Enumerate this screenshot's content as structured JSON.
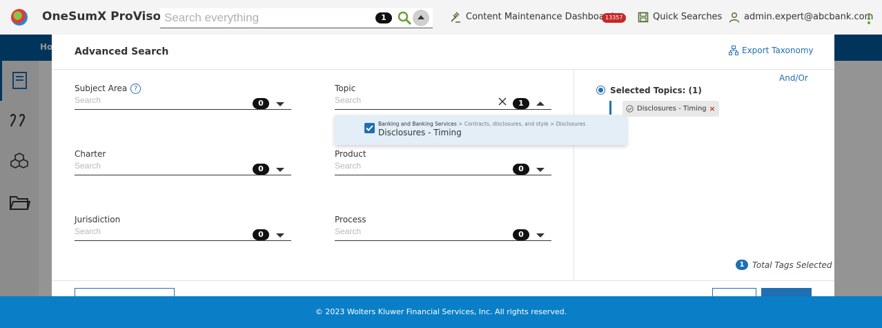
{
  "header": {
    "app_title": "OneSumX ProViso",
    "search_placeholder": "Search everything",
    "search_count": "1",
    "content_maintenance_label": "Content Maintenance Dashboard",
    "content_maintenance_badge": "13357",
    "quick_searches_label": "Quick Searches",
    "user_email": "admin.expert@abcbank.com"
  },
  "background_nav": {
    "home_label": "Ho"
  },
  "modal": {
    "title": "Advanced Search",
    "export_label": "Export Taxonomy",
    "fields": [
      {
        "label": "Subject Area",
        "placeholder": "Search",
        "count": "0"
      },
      {
        "label": "Topic",
        "placeholder": "Search",
        "count": "1"
      },
      {
        "label": "Charter",
        "placeholder": "Search",
        "count": "0"
      },
      {
        "label": "Product",
        "placeholder": "Search",
        "count": "0"
      },
      {
        "label": "Jurisdiction",
        "placeholder": "Search",
        "count": "0"
      },
      {
        "label": "Process",
        "placeholder": "Search",
        "count": "0"
      }
    ],
    "topic_dropdown": {
      "path_root": "Banking and Banking Services",
      "path_rest": " > Contracts, disclosures, and style > Disclosures",
      "item_label": "Disclosures - Timing",
      "checked": true
    },
    "right_panel": {
      "andor_label": "And/Or",
      "selected_title": "Selected Topics: (1)",
      "chips": [
        "Disclosures - Timing"
      ],
      "total_count": "1",
      "total_label": "Total Tags Selected"
    }
  },
  "footer": {
    "copyright": "© 2023 Wolters Kluwer Financial Services, Inc. All rights reserved."
  },
  "colors": {
    "primary": "#1f6fb2",
    "navbar": "#005b9c",
    "footer": "#0a7fc7",
    "badge": "#c62828",
    "accent_green": "#689f38"
  }
}
